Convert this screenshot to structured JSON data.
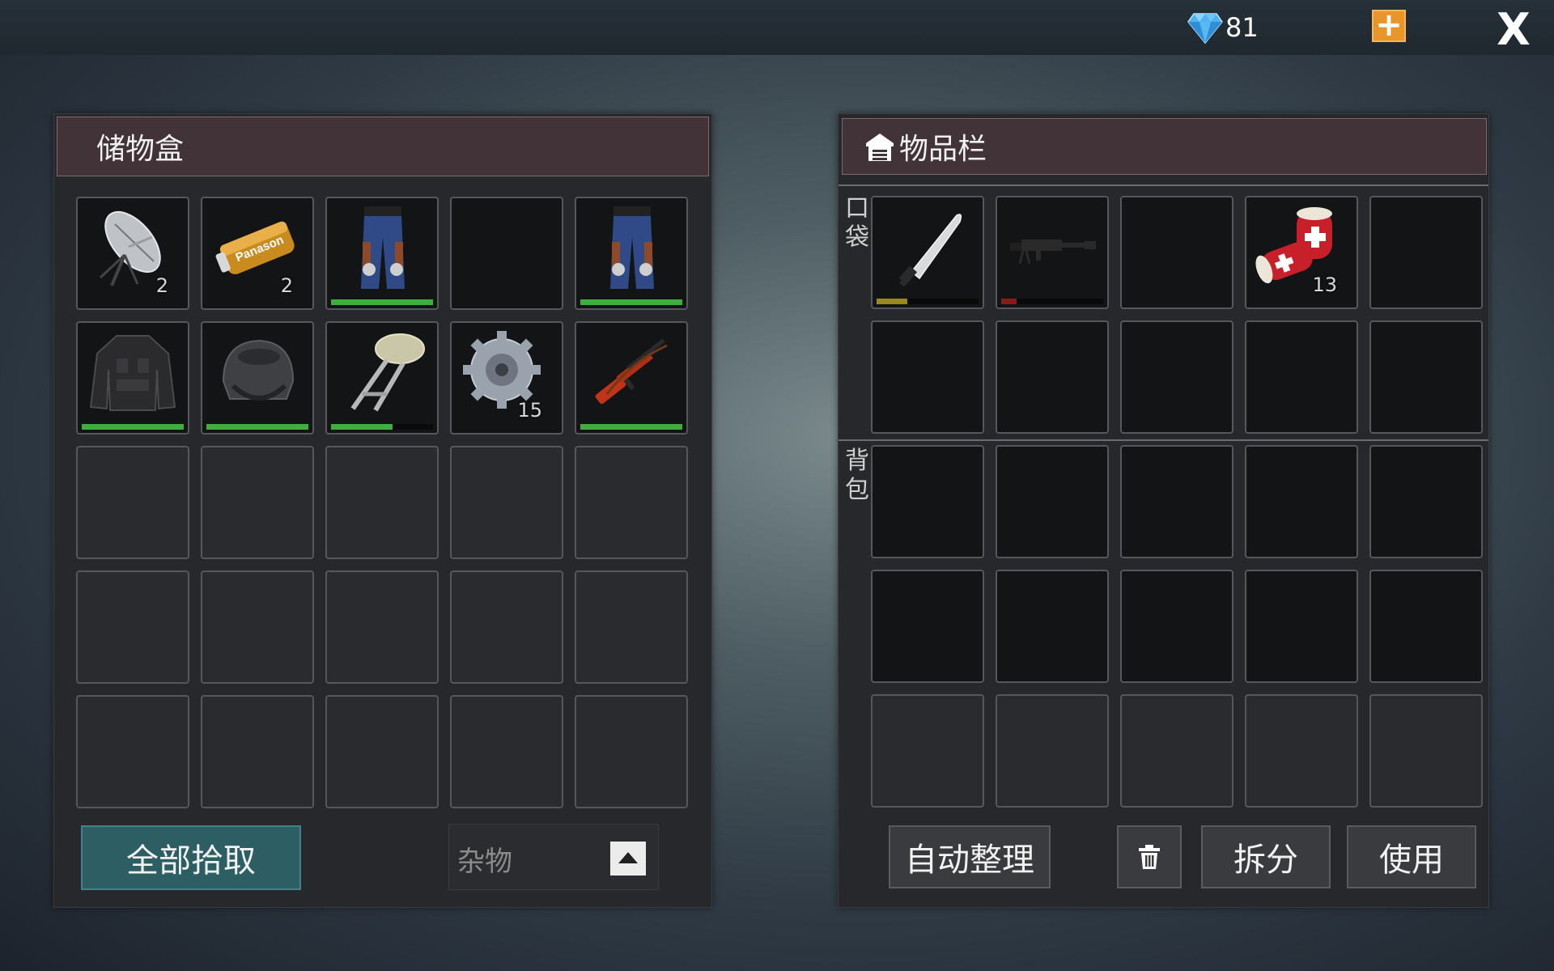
{
  "topbar": {
    "gems": "81",
    "plus_label": "+",
    "close_label": "X"
  },
  "storage": {
    "title": "储物盒",
    "slots": [
      {
        "item": "satellite-dish",
        "count": "2",
        "durability": null
      },
      {
        "item": "battery",
        "count": "2",
        "durability": null,
        "label": "Panason"
      },
      {
        "item": "camo-pants",
        "count": "",
        "durability": 1.0
      },
      {
        "item": "empty",
        "count": "",
        "durability": null
      },
      {
        "item": "camo-pants",
        "count": "",
        "durability": 1.0
      },
      {
        "item": "tactical-jacket",
        "count": "",
        "durability": 1.0
      },
      {
        "item": "combat-helmet",
        "count": "",
        "durability": 1.0
      },
      {
        "item": "stool",
        "count": "",
        "durability": 0.6
      },
      {
        "item": "gear",
        "count": "15",
        "durability": null
      },
      {
        "item": "rifle",
        "count": "",
        "durability": 1.0
      }
    ],
    "pick_all_label": "全部拾取",
    "filter_value": "杂物"
  },
  "inventory": {
    "title": "物品栏",
    "pocket_label": [
      "口",
      "袋"
    ],
    "backpack_label": [
      "背",
      "包"
    ],
    "pocket_slots": [
      {
        "item": "machete",
        "count": "",
        "durability": 0.3,
        "bar_color": "#9a8a1c"
      },
      {
        "item": "machine-gun",
        "count": "",
        "durability": 0.15,
        "bar_color": "#8a1a1a"
      },
      {
        "item": "empty",
        "count": "",
        "durability": null
      },
      {
        "item": "bandage",
        "count": "13",
        "durability": null
      },
      {
        "item": "empty",
        "count": "",
        "durability": null
      }
    ],
    "sort_label": "自动整理",
    "split_label": "拆分",
    "use_label": "使用"
  },
  "colors": {
    "durability_full": "#3fae3f",
    "accent_orange": "#e8952a",
    "pick_all_bg": "#2c5e63"
  }
}
